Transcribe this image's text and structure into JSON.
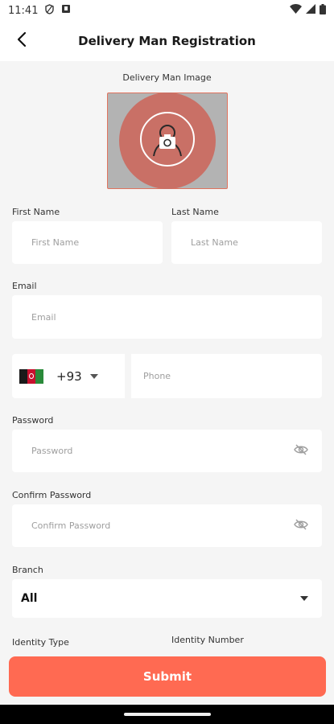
{
  "status_bar": {
    "time": "11:41",
    "icons": [
      "vpn-shield-icon",
      "sim-notification-icon",
      "wifi-icon",
      "signal-icon",
      "battery-icon"
    ]
  },
  "header": {
    "title": "Delivery Man Registration",
    "back_icon": "arrow-left-icon"
  },
  "image_picker": {
    "label": "Delivery Man Image",
    "icon": "camera-user-icon"
  },
  "form": {
    "first_name": {
      "label": "First Name",
      "placeholder": "First Name",
      "value": ""
    },
    "last_name": {
      "label": "Last Name",
      "placeholder": "Last Name",
      "value": ""
    },
    "email": {
      "label": "Email",
      "placeholder": "Email",
      "value": ""
    },
    "phone": {
      "country_code": "+93",
      "flag": "afghanistan-flag-icon",
      "placeholder": "Phone",
      "value": ""
    },
    "password": {
      "label": "Password",
      "placeholder": "Password",
      "value": "",
      "eye_icon": "eye-off-icon"
    },
    "confirm_password": {
      "label": "Confirm Password",
      "placeholder": "Confirm Password",
      "value": "",
      "eye_icon": "eye-off-icon"
    },
    "branch": {
      "label": "Branch",
      "selected": "All"
    },
    "identity_type": {
      "label": "Identity Type"
    },
    "identity_number": {
      "label": "Identity Number"
    }
  },
  "submit": {
    "label": "Submit"
  },
  "colors": {
    "accent": "#ff6a52",
    "background": "#f5f5f5",
    "field_background": "#ffffff",
    "image_box_bg": "#b3b3b3",
    "image_circle": "#c97066"
  }
}
